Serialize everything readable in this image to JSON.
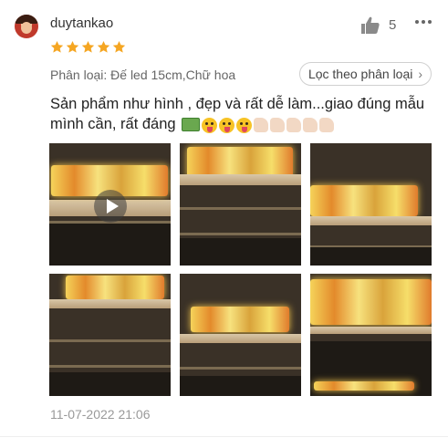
{
  "reviewer": {
    "username": "duytankao",
    "rating": 5
  },
  "like": {
    "count": "5",
    "icon": "thumbs-up-icon"
  },
  "menu": {
    "icon": "more-icon"
  },
  "variant": {
    "label": "Phân loại: Đế led 15cm,Chữ hoa"
  },
  "filter": {
    "label": "Lọc theo phân loại",
    "icon": "chevron-right-icon"
  },
  "review": {
    "text": "Sản phẩm như hình , đẹp và rất dễ làm...giao đúng mẫu mình cần, rất đáng",
    "emojis": [
      "cash-icon",
      "tongue-face-icon",
      "tongue-face-icon",
      "tongue-face-icon",
      "thumbs-up-icon",
      "thumbs-up-icon",
      "thumbs-up-icon",
      "thumbs-up-icon",
      "thumbs-up-icon"
    ]
  },
  "media": {
    "tiles": [
      {
        "type": "video",
        "alt": "video"
      },
      {
        "type": "photo",
        "alt": "photo"
      },
      {
        "type": "photo",
        "alt": "photo"
      },
      {
        "type": "photo",
        "alt": "photo"
      },
      {
        "type": "photo",
        "alt": "photo"
      },
      {
        "type": "photo",
        "alt": "photo"
      }
    ]
  },
  "date": "11-07-2022 21:06",
  "colors": {
    "star": "#f5a623",
    "text": "#222222",
    "muted": "#999999"
  }
}
